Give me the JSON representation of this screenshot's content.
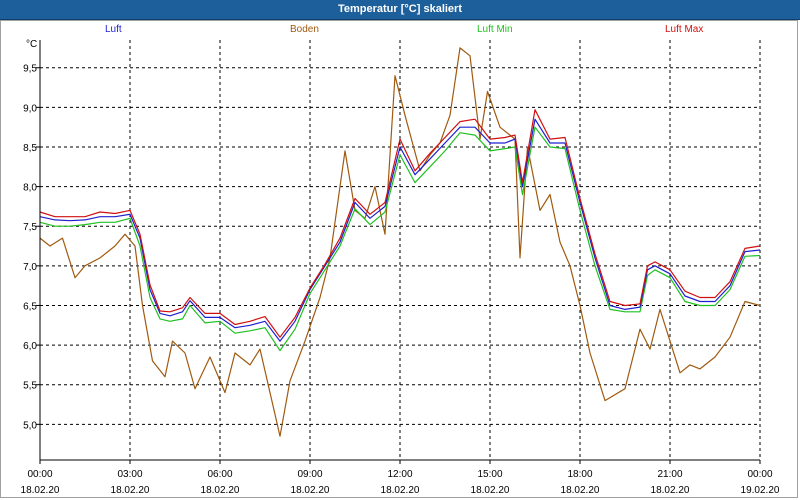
{
  "window": {
    "title": "Temperatur [°C] skaliert"
  },
  "legend": [
    {
      "name": "Luft",
      "color": "#2020d0"
    },
    {
      "name": "Boden",
      "color": "#a05a10"
    },
    {
      "name": "Luft Min",
      "color": "#20c020"
    },
    {
      "name": "Luft Max",
      "color": "#d01010"
    }
  ],
  "chart_data": {
    "type": "line",
    "title": "Temperatur [°C] skaliert",
    "ylabel": "°C",
    "ylim": [
      4.55,
      9.85
    ],
    "xlim": [
      "18.02.20 00:00",
      "19.02.20 00:00"
    ],
    "grid": true,
    "legend_position": "top",
    "y_ticks": [
      "5,0",
      "5,5",
      "6,0",
      "6,5",
      "7,0",
      "7,5",
      "8,0",
      "8,5",
      "9,0",
      "9,5"
    ],
    "x_ticks": [
      {
        "time": "00:00",
        "date": "18.02.20"
      },
      {
        "time": "03:00",
        "date": "18.02.20"
      },
      {
        "time": "06:00",
        "date": "18.02.20"
      },
      {
        "time": "09:00",
        "date": "18.02.20"
      },
      {
        "time": "12:00",
        "date": "18.02.20"
      },
      {
        "time": "15:00",
        "date": "18.02.20"
      },
      {
        "time": "18:00",
        "date": "18.02.20"
      },
      {
        "time": "21:00",
        "date": "18.02.20"
      },
      {
        "time": "00:00",
        "date": "19.02.20"
      }
    ],
    "series": [
      {
        "name": "Luft",
        "color": "#2020d0",
        "points": [
          [
            "00:00",
            7.62
          ],
          [
            "00:30",
            7.58
          ],
          [
            "01:00",
            7.57
          ],
          [
            "01:30",
            7.58
          ],
          [
            "02:00",
            7.62
          ],
          [
            "02:30",
            7.62
          ],
          [
            "03:00",
            7.65
          ],
          [
            "03:20",
            7.35
          ],
          [
            "03:40",
            6.7
          ],
          [
            "04:00",
            6.4
          ],
          [
            "04:20",
            6.37
          ],
          [
            "04:45",
            6.42
          ],
          [
            "05:00",
            6.56
          ],
          [
            "05:30",
            6.35
          ],
          [
            "06:00",
            6.35
          ],
          [
            "06:30",
            6.22
          ],
          [
            "07:00",
            6.25
          ],
          [
            "07:30",
            6.3
          ],
          [
            "08:00",
            6.05
          ],
          [
            "08:30",
            6.3
          ],
          [
            "09:00",
            6.7
          ],
          [
            "09:30",
            7.0
          ],
          [
            "10:00",
            7.3
          ],
          [
            "10:30",
            7.8
          ],
          [
            "11:00",
            7.6
          ],
          [
            "11:30",
            7.75
          ],
          [
            "12:00",
            8.5
          ],
          [
            "12:30",
            8.15
          ],
          [
            "13:00",
            8.35
          ],
          [
            "13:30",
            8.55
          ],
          [
            "14:00",
            8.75
          ],
          [
            "14:30",
            8.75
          ],
          [
            "15:00",
            8.55
          ],
          [
            "15:30",
            8.55
          ],
          [
            "15:50",
            8.6
          ],
          [
            "16:05",
            8.0
          ],
          [
            "16:30",
            8.85
          ],
          [
            "17:00",
            8.55
          ],
          [
            "17:30",
            8.55
          ],
          [
            "18:00",
            7.8
          ],
          [
            "18:30",
            7.1
          ],
          [
            "19:00",
            6.5
          ],
          [
            "19:30",
            6.45
          ],
          [
            "20:00",
            6.48
          ],
          [
            "20:15",
            6.95
          ],
          [
            "20:30",
            7.0
          ],
          [
            "21:00",
            6.9
          ],
          [
            "21:30",
            6.62
          ],
          [
            "22:00",
            6.55
          ],
          [
            "22:30",
            6.55
          ],
          [
            "23:00",
            6.75
          ],
          [
            "23:30",
            7.18
          ],
          [
            "24:00",
            7.2
          ]
        ]
      },
      {
        "name": "Boden",
        "color": "#a05a10",
        "points": [
          [
            "00:00",
            7.35
          ],
          [
            "00:20",
            7.25
          ],
          [
            "00:45",
            7.35
          ],
          [
            "01:10",
            6.85
          ],
          [
            "01:30",
            7.0
          ],
          [
            "02:00",
            7.1
          ],
          [
            "02:30",
            7.25
          ],
          [
            "02:50",
            7.4
          ],
          [
            "03:10",
            7.25
          ],
          [
            "03:25",
            6.5
          ],
          [
            "03:45",
            5.8
          ],
          [
            "04:10",
            5.6
          ],
          [
            "04:25",
            6.05
          ],
          [
            "04:50",
            5.9
          ],
          [
            "05:10",
            5.45
          ],
          [
            "05:40",
            5.85
          ],
          [
            "06:10",
            5.4
          ],
          [
            "06:30",
            5.9
          ],
          [
            "07:00",
            5.75
          ],
          [
            "07:20",
            5.95
          ],
          [
            "07:40",
            5.4
          ],
          [
            "08:00",
            4.85
          ],
          [
            "08:20",
            5.55
          ],
          [
            "08:50",
            6.05
          ],
          [
            "09:20",
            6.6
          ],
          [
            "09:40",
            7.1
          ],
          [
            "10:10",
            8.45
          ],
          [
            "10:30",
            7.7
          ],
          [
            "10:50",
            7.6
          ],
          [
            "11:10",
            8.0
          ],
          [
            "11:30",
            7.4
          ],
          [
            "11:50",
            9.4
          ],
          [
            "12:10",
            8.9
          ],
          [
            "12:40",
            8.2
          ],
          [
            "13:00",
            8.4
          ],
          [
            "13:20",
            8.55
          ],
          [
            "13:40",
            8.9
          ],
          [
            "14:00",
            9.75
          ],
          [
            "14:20",
            9.65
          ],
          [
            "14:40",
            8.6
          ],
          [
            "14:55",
            9.2
          ],
          [
            "15:20",
            8.75
          ],
          [
            "15:50",
            8.6
          ],
          [
            "16:00",
            7.1
          ],
          [
            "16:15",
            8.5
          ],
          [
            "16:40",
            7.7
          ],
          [
            "17:00",
            7.9
          ],
          [
            "17:20",
            7.3
          ],
          [
            "17:40",
            7.0
          ],
          [
            "18:00",
            6.5
          ],
          [
            "18:20",
            5.9
          ],
          [
            "18:50",
            5.3
          ],
          [
            "19:30",
            5.45
          ],
          [
            "20:00",
            6.2
          ],
          [
            "20:20",
            5.95
          ],
          [
            "20:40",
            6.45
          ],
          [
            "21:00",
            6.05
          ],
          [
            "21:20",
            5.65
          ],
          [
            "21:40",
            5.75
          ],
          [
            "22:00",
            5.7
          ],
          [
            "22:30",
            5.85
          ],
          [
            "23:00",
            6.1
          ],
          [
            "23:30",
            6.55
          ],
          [
            "24:00",
            6.5
          ]
        ]
      },
      {
        "name": "Luft Min",
        "color": "#20c020",
        "points": [
          [
            "00:00",
            7.55
          ],
          [
            "00:30",
            7.5
          ],
          [
            "01:00",
            7.5
          ],
          [
            "01:30",
            7.52
          ],
          [
            "02:00",
            7.55
          ],
          [
            "02:30",
            7.55
          ],
          [
            "03:00",
            7.6
          ],
          [
            "03:20",
            7.25
          ],
          [
            "03:40",
            6.6
          ],
          [
            "04:00",
            6.33
          ],
          [
            "04:20",
            6.3
          ],
          [
            "04:45",
            6.33
          ],
          [
            "05:00",
            6.5
          ],
          [
            "05:30",
            6.28
          ],
          [
            "06:00",
            6.3
          ],
          [
            "06:30",
            6.15
          ],
          [
            "07:00",
            6.18
          ],
          [
            "07:30",
            6.22
          ],
          [
            "08:00",
            5.93
          ],
          [
            "08:30",
            6.2
          ],
          [
            "09:00",
            6.65
          ],
          [
            "09:30",
            6.95
          ],
          [
            "10:00",
            7.25
          ],
          [
            "10:30",
            7.72
          ],
          [
            "11:00",
            7.52
          ],
          [
            "11:30",
            7.68
          ],
          [
            "12:00",
            8.4
          ],
          [
            "12:30",
            8.05
          ],
          [
            "13:00",
            8.25
          ],
          [
            "13:30",
            8.45
          ],
          [
            "14:00",
            8.68
          ],
          [
            "14:30",
            8.65
          ],
          [
            "15:00",
            8.45
          ],
          [
            "15:30",
            8.48
          ],
          [
            "15:50",
            8.5
          ],
          [
            "16:05",
            7.9
          ],
          [
            "16:30",
            8.75
          ],
          [
            "17:00",
            8.5
          ],
          [
            "17:30",
            8.48
          ],
          [
            "18:00",
            7.7
          ],
          [
            "18:30",
            7.0
          ],
          [
            "19:00",
            6.45
          ],
          [
            "19:30",
            6.42
          ],
          [
            "20:00",
            6.42
          ],
          [
            "20:15",
            6.88
          ],
          [
            "20:30",
            6.95
          ],
          [
            "21:00",
            6.85
          ],
          [
            "21:30",
            6.55
          ],
          [
            "22:00",
            6.5
          ],
          [
            "22:30",
            6.5
          ],
          [
            "23:00",
            6.7
          ],
          [
            "23:30",
            7.12
          ],
          [
            "24:00",
            7.13
          ]
        ]
      },
      {
        "name": "Luft Max",
        "color": "#d01010",
        "points": [
          [
            "00:00",
            7.68
          ],
          [
            "00:30",
            7.62
          ],
          [
            "01:00",
            7.62
          ],
          [
            "01:30",
            7.62
          ],
          [
            "02:00",
            7.68
          ],
          [
            "02:30",
            7.66
          ],
          [
            "03:00",
            7.7
          ],
          [
            "03:20",
            7.4
          ],
          [
            "03:40",
            6.76
          ],
          [
            "04:00",
            6.43
          ],
          [
            "04:20",
            6.42
          ],
          [
            "04:45",
            6.47
          ],
          [
            "05:00",
            6.6
          ],
          [
            "05:30",
            6.4
          ],
          [
            "06:00",
            6.4
          ],
          [
            "06:30",
            6.26
          ],
          [
            "07:00",
            6.3
          ],
          [
            "07:30",
            6.36
          ],
          [
            "08:00",
            6.1
          ],
          [
            "08:30",
            6.35
          ],
          [
            "09:00",
            6.72
          ],
          [
            "09:30",
            7.02
          ],
          [
            "10:00",
            7.35
          ],
          [
            "10:30",
            7.85
          ],
          [
            "11:00",
            7.65
          ],
          [
            "11:30",
            7.8
          ],
          [
            "12:00",
            8.6
          ],
          [
            "12:30",
            8.2
          ],
          [
            "13:00",
            8.42
          ],
          [
            "13:30",
            8.62
          ],
          [
            "14:00",
            8.82
          ],
          [
            "14:30",
            8.85
          ],
          [
            "15:00",
            8.6
          ],
          [
            "15:30",
            8.62
          ],
          [
            "15:50",
            8.65
          ],
          [
            "16:05",
            8.05
          ],
          [
            "16:30",
            8.97
          ],
          [
            "17:00",
            8.6
          ],
          [
            "17:30",
            8.62
          ],
          [
            "18:00",
            7.85
          ],
          [
            "18:30",
            7.15
          ],
          [
            "19:00",
            6.55
          ],
          [
            "19:30",
            6.5
          ],
          [
            "20:00",
            6.52
          ],
          [
            "20:15",
            7.0
          ],
          [
            "20:30",
            7.05
          ],
          [
            "21:00",
            6.95
          ],
          [
            "21:30",
            6.68
          ],
          [
            "22:00",
            6.6
          ],
          [
            "22:30",
            6.6
          ],
          [
            "23:00",
            6.8
          ],
          [
            "23:30",
            7.22
          ],
          [
            "24:00",
            7.25
          ]
        ]
      }
    ]
  }
}
